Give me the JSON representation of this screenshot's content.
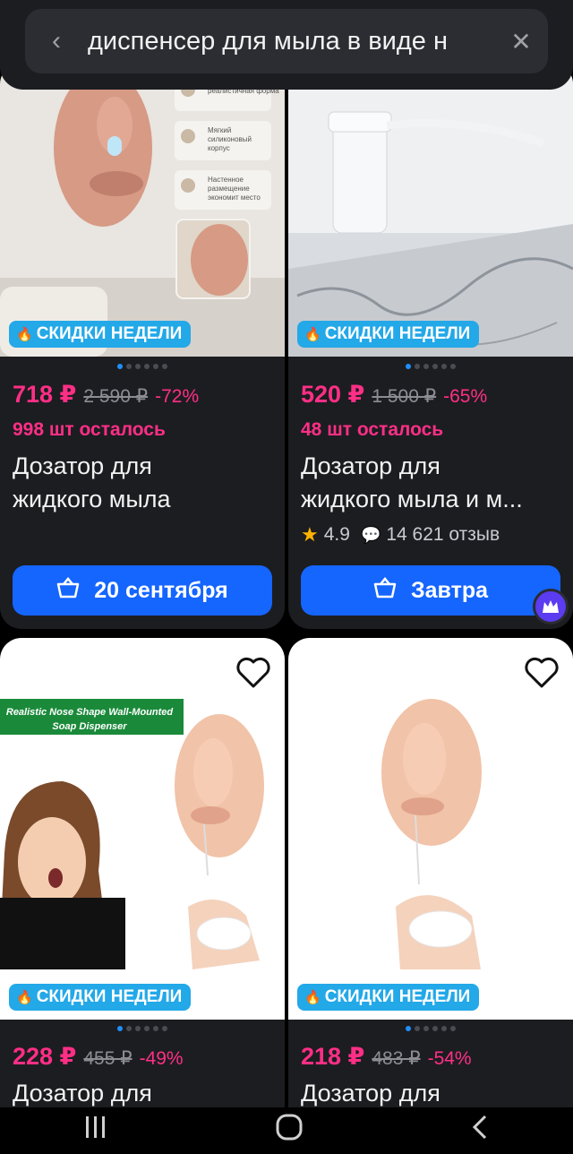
{
  "search": {
    "query": "диспенсер для мыла в виде н"
  },
  "badge_label": "СКИДКИ НЕДЕЛИ",
  "products": [
    {
      "price": "718 ₽",
      "old_price": "2 590 ₽",
      "discount": "-72%",
      "stock": "998 шт осталось",
      "title_line1": "Дозатор для",
      "title_line2": "жидкого мыла",
      "delivery": "20 сентября",
      "image_text": {
        "f1": "реалистичная форма",
        "f2a": "Мягкий",
        "f2b": "силиконовый",
        "f2c": "корпус",
        "f3a": "Настенное",
        "f3b": "размещение",
        "f3c": "экономит место"
      }
    },
    {
      "price": "520 ₽",
      "old_price": "1 500 ₽",
      "discount": "-65%",
      "stock": "48 шт осталось",
      "title_line1": "Дозатор для",
      "title_line2": "жидкого мыла и м...",
      "rating": "4.9",
      "reviews": "14 621 отзыв",
      "delivery": "Завтра"
    },
    {
      "price": "228 ₽",
      "old_price": "455 ₽",
      "discount": "-49%",
      "title_line1": "Дозатор для",
      "image_banner_1": "Realistic Nose Shape Wall-Mounted",
      "image_banner_2": "Soap Dispenser"
    },
    {
      "price": "218 ₽",
      "old_price": "483 ₽",
      "discount": "-54%",
      "title_line1": "Дозатор для"
    }
  ],
  "colors": {
    "accent": "#1565ff",
    "price": "#ff2f86",
    "badge": "#23a8e8",
    "card_bg": "#1c1d21"
  }
}
